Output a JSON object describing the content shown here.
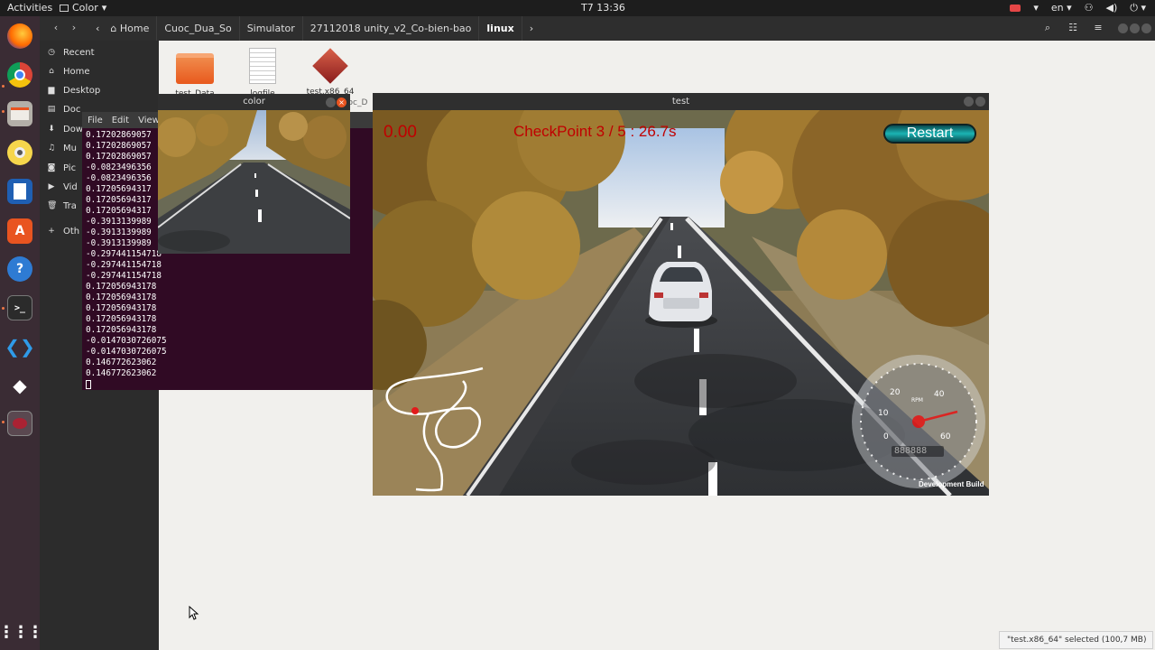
{
  "topbar": {
    "activities": "Activities",
    "app_menu": "Color",
    "clock": "T7 13:36",
    "lang": "en"
  },
  "dock": {
    "items": [
      "firefox-icon",
      "chrome-icon",
      "files-icon",
      "rhythmbox-icon",
      "writer-icon",
      "software-icon",
      "help-icon",
      "terminal-icon",
      "vscode-icon",
      "unity-icon",
      "app-icon"
    ]
  },
  "fm": {
    "breadcrumbs": [
      "Home",
      "Cuoc_Dua_So",
      "Simulator",
      "27112018 unity_v2_Co-bien-bao",
      "linux"
    ],
    "sidebar": [
      {
        "label": "Recent",
        "icon": "clock-icon"
      },
      {
        "label": "Home",
        "icon": "home-icon"
      },
      {
        "label": "Desktop",
        "icon": "folder-icon"
      },
      {
        "label": "Doc",
        "icon": "document-icon"
      },
      {
        "label": "Dow",
        "icon": "download-icon"
      },
      {
        "label": "Mu",
        "icon": "music-icon"
      },
      {
        "label": "Pic",
        "icon": "camera-icon"
      },
      {
        "label": "Vid",
        "icon": "video-icon"
      },
      {
        "label": "Tra",
        "icon": "trash-icon"
      },
      {
        "label": "Oth",
        "icon": "plus-icon"
      }
    ],
    "files": [
      {
        "name": "test_Data",
        "kind": "folder"
      },
      {
        "name": "logfile",
        "kind": "text"
      },
      {
        "name": "test.x86_64",
        "kind": "exec"
      }
    ],
    "partial_label": "ioc_D"
  },
  "terminal": {
    "menu": [
      "File",
      "Edit",
      "View"
    ],
    "lines": [
      "0.17202869057",
      "0.17202869057",
      "0.17202869057",
      "-0.0823496356",
      "-0.0823496356",
      "0.17205694317",
      "0.17205694317",
      "0.17205694317",
      "-0.3913139989",
      "-0.3913139989",
      "-0.3913139989",
      "-0.297441154718",
      "-0.297441154718",
      "-0.297441154718",
      "0.172056943178",
      "0.172056943178",
      "0.172056943178",
      "0.172056943178",
      "0.172056943178",
      "-0.0147030726075",
      "-0.0147030726075",
      "0.146772623062",
      "0.146772623062"
    ]
  },
  "color_window": {
    "title": "color"
  },
  "game_window": {
    "title": "test",
    "timer": "0.00",
    "checkpoint": "CheckPoint 3 / 5 : 26.7s",
    "restart_label": "Restart",
    "speedo_numbers": [
      "20",
      "40",
      "10",
      "60",
      "0"
    ],
    "speedo_unit": "RPM",
    "odometer": "888888",
    "dev_build": "Development Build"
  },
  "status": {
    "text": "\"test.x86_64\" selected (100,7 MB)"
  },
  "colors": {
    "accent": "#e95420",
    "hud_red": "#c00000",
    "terminal_bg": "#300a24"
  }
}
